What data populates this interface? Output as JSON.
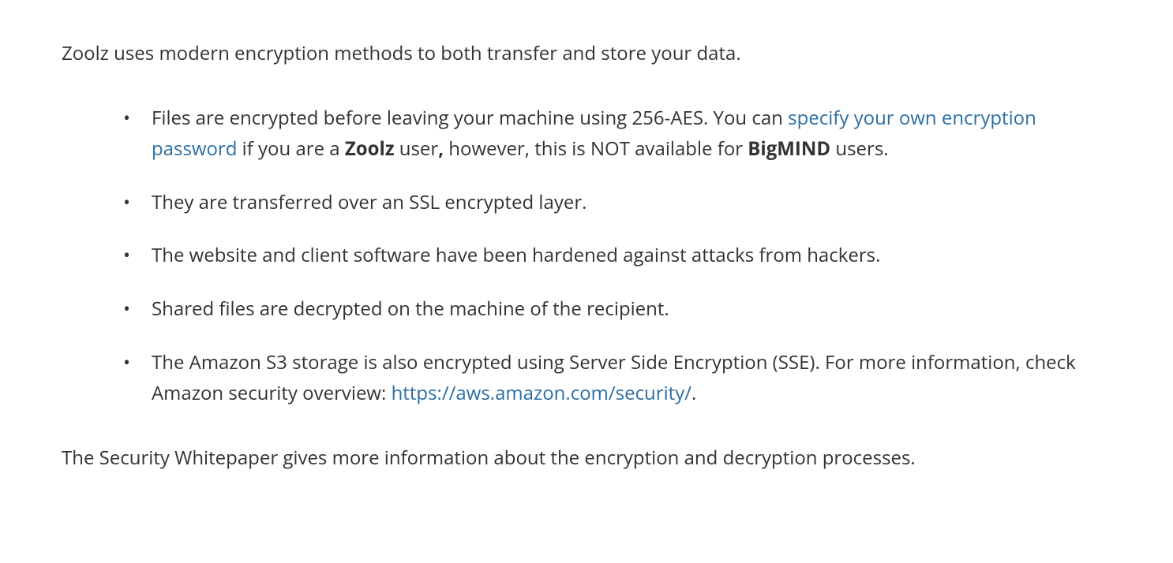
{
  "intro": "Zoolz uses modern encryption methods to both transfer and store your data.",
  "bullets": {
    "b1_part1": "Files are encrypted before leaving your machine using 256-AES. You can ",
    "b1_link": "specify your own encryption password",
    "b1_part2": " if you are a ",
    "b1_bold1": "Zoolz",
    "b1_part3": " user",
    "b1_comma": ",",
    "b1_part4": " however, this is NOT available for ",
    "b1_bold2": "BigMIND",
    "b1_part5": " users.",
    "b2": "They are transferred over an SSL encrypted layer.",
    "b3": "The website and client software have been hardened against attacks from hackers.",
    "b4": "Shared files are decrypted on the machine of the recipient.",
    "b5_part1": "The Amazon S3 storage is also encrypted using Server Side Encryption (SSE). For more information, check Amazon security overview: ",
    "b5_link": "https://aws.amazon.com/security/",
    "b5_part2": "."
  },
  "outro": "The Security Whitepaper gives more information about the encryption and decryption processes."
}
